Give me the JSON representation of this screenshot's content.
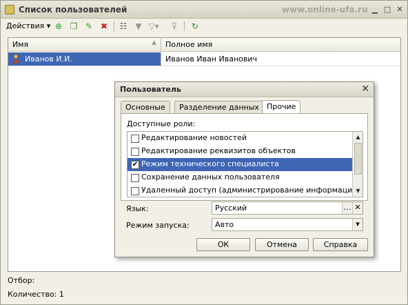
{
  "window": {
    "title": "Список пользователей",
    "watermark": "www.online-ufa.ru"
  },
  "toolbar": {
    "actions_label": "Действия ▾"
  },
  "table": {
    "headers": [
      "Имя",
      "Полное имя"
    ],
    "rows": [
      {
        "name": "Иванов И.И.",
        "full_name": "Иванов Иван Иванович"
      }
    ]
  },
  "status": {
    "filter": "Отбор:",
    "count": "Количество: 1"
  },
  "dialog": {
    "title": "Пользователь",
    "tabs": [
      "Основные",
      "Разделение данных",
      "Прочие"
    ],
    "active_tab": "Прочие",
    "roles_label": "Доступные роли:",
    "roles": [
      {
        "label": "Редактирование новостей",
        "checked": false
      },
      {
        "label": "Редактирование реквизитов объектов",
        "checked": false
      },
      {
        "label": "Режим технического специалиста",
        "checked": true
      },
      {
        "label": "Сохранение данных пользователя",
        "checked": false
      },
      {
        "label": "Удаленный доступ (администрирование информационной...",
        "checked": false
      }
    ],
    "language_label": "Язык:",
    "language_value": "Русский",
    "mode_label": "Режим запуска:",
    "mode_value": "Авто",
    "buttons": {
      "ok": "ОК",
      "cancel": "Отмена",
      "help": "Справка"
    }
  },
  "colors": {
    "selection": "#3f66b5",
    "background": "#f2f0e6"
  }
}
